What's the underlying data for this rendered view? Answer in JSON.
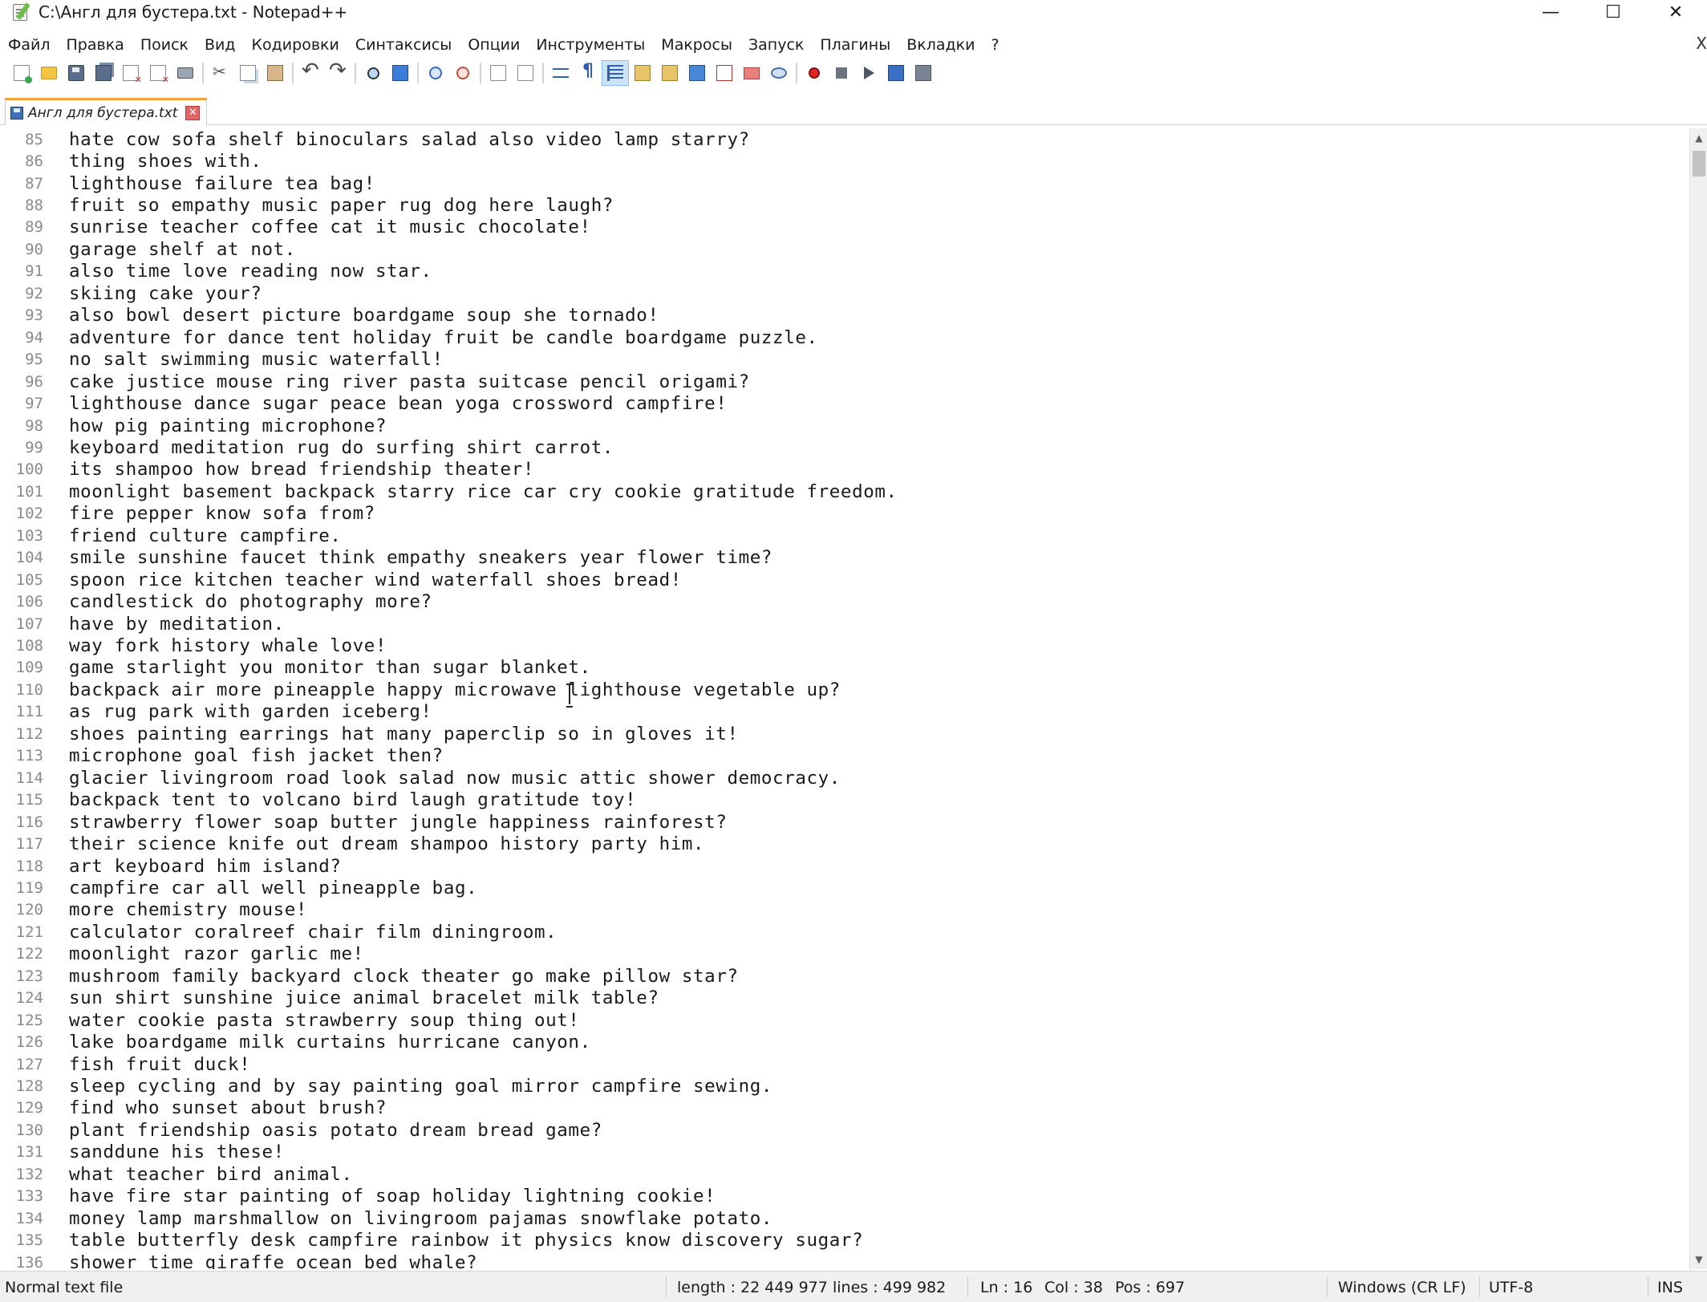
{
  "window": {
    "title": "C:\\Англ для бустера.txt - Notepad++",
    "minimize": "—",
    "maximize": "☐",
    "close": "✕"
  },
  "menu": {
    "items": [
      "Файл",
      "Правка",
      "Поиск",
      "Вид",
      "Кодировки",
      "Синтаксисы",
      "Опции",
      "Инструменты",
      "Макросы",
      "Запуск",
      "Плагины",
      "Вкладки",
      "?"
    ],
    "close_doc": "X"
  },
  "toolbar": {
    "buttons": [
      "new-file",
      "open-file",
      "save",
      "save-all",
      "close",
      "close-all",
      "print",
      "cut",
      "copy",
      "paste",
      "undo",
      "redo",
      "find",
      "replace",
      "zoom-in",
      "zoom-out",
      "sync-vertical",
      "sync-horizontal",
      "word-wrap",
      "show-all-chars",
      "indent-guide",
      "document-map",
      "function-list",
      "folder-as-workspace",
      "monitoring",
      "doc-list",
      "record-macro",
      "stop-recording",
      "playback-macro",
      "run-macro-multiple",
      "save-macro"
    ]
  },
  "tab": {
    "label": "Англ для бустера.txt",
    "close": "✕"
  },
  "editor": {
    "lines": [
      {
        "n": "85",
        "t": "hate cow sofa shelf binoculars salad also video lamp starry?"
      },
      {
        "n": "86",
        "t": "thing shoes with."
      },
      {
        "n": "87",
        "t": "lighthouse failure tea bag!"
      },
      {
        "n": "88",
        "t": "fruit so empathy music paper rug dog here laugh?"
      },
      {
        "n": "89",
        "t": "sunrise teacher coffee cat it music chocolate!"
      },
      {
        "n": "90",
        "t": "garage shelf at not."
      },
      {
        "n": "91",
        "t": "also time love reading now star."
      },
      {
        "n": "92",
        "t": "skiing cake your?"
      },
      {
        "n": "93",
        "t": "also bowl desert picture boardgame soup she tornado!"
      },
      {
        "n": "94",
        "t": "adventure for dance tent holiday fruit be candle boardgame puzzle."
      },
      {
        "n": "95",
        "t": "no salt swimming music waterfall!"
      },
      {
        "n": "96",
        "t": "cake justice mouse ring river pasta suitcase pencil origami?"
      },
      {
        "n": "97",
        "t": "lighthouse dance sugar peace bean yoga crossword campfire!"
      },
      {
        "n": "98",
        "t": "how pig painting microphone?"
      },
      {
        "n": "99",
        "t": "keyboard meditation rug do surfing shirt carrot."
      },
      {
        "n": "100",
        "t": "its shampoo how bread friendship theater!"
      },
      {
        "n": "101",
        "t": "moonlight basement backpack starry rice car cry cookie gratitude freedom."
      },
      {
        "n": "102",
        "t": "fire pepper know sofa from?"
      },
      {
        "n": "103",
        "t": "friend culture campfire."
      },
      {
        "n": "104",
        "t": "smile sunshine faucet think empathy sneakers year flower time?"
      },
      {
        "n": "105",
        "t": "spoon rice kitchen teacher wind waterfall shoes bread!"
      },
      {
        "n": "106",
        "t": "candlestick do photography more?"
      },
      {
        "n": "107",
        "t": "have by meditation."
      },
      {
        "n": "108",
        "t": "way fork history whale love!"
      },
      {
        "n": "109",
        "t": "game starlight you monitor than sugar blanket."
      },
      {
        "n": "110",
        "t": "backpack air more pineapple happy microwave lighthouse vegetable up?"
      },
      {
        "n": "111",
        "t": "as rug park with garden iceberg!"
      },
      {
        "n": "112",
        "t": "shoes painting earrings hat many paperclip so in gloves it!"
      },
      {
        "n": "113",
        "t": "microphone goal fish jacket then?"
      },
      {
        "n": "114",
        "t": "glacier livingroom road look salad now music attic shower democracy."
      },
      {
        "n": "115",
        "t": "backpack tent to volcano bird laugh gratitude toy!"
      },
      {
        "n": "116",
        "t": "strawberry flower soap butter jungle happiness rainforest?"
      },
      {
        "n": "117",
        "t": "their science knife out dream shampoo history party him."
      },
      {
        "n": "118",
        "t": "art keyboard him island?"
      },
      {
        "n": "119",
        "t": "campfire car all well pineapple bag."
      },
      {
        "n": "120",
        "t": "more chemistry mouse!"
      },
      {
        "n": "121",
        "t": "calculator coralreef chair film diningroom."
      },
      {
        "n": "122",
        "t": "moonlight razor garlic me!"
      },
      {
        "n": "123",
        "t": "mushroom family backyard clock theater go make pillow star?"
      },
      {
        "n": "124",
        "t": "sun shirt sunshine juice animal bracelet milk table?"
      },
      {
        "n": "125",
        "t": "water cookie pasta strawberry soup thing out!"
      },
      {
        "n": "126",
        "t": "lake boardgame milk curtains hurricane canyon."
      },
      {
        "n": "127",
        "t": "fish fruit duck!"
      },
      {
        "n": "128",
        "t": "sleep cycling and by say painting goal mirror campfire sewing."
      },
      {
        "n": "129",
        "t": "find who sunset about brush?"
      },
      {
        "n": "130",
        "t": "plant friendship oasis potato dream bread game?"
      },
      {
        "n": "131",
        "t": "sanddune his these!"
      },
      {
        "n": "132",
        "t": "what teacher bird animal."
      },
      {
        "n": "133",
        "t": "have fire star painting of soap holiday lightning cookie!"
      },
      {
        "n": "134",
        "t": "money lamp marshmallow on livingroom pajamas snowflake potato."
      },
      {
        "n": "135",
        "t": "table butterfly desk campfire rainbow it physics know discovery sugar?"
      },
      {
        "n": "136",
        "t": "shower time giraffe ocean bed whale?"
      }
    ]
  },
  "scrollbar": {
    "up": "▲",
    "down": "▼"
  },
  "status": {
    "file_type": "Normal text file",
    "length": "length : 22 449 977",
    "lines": "lines : 499 982",
    "ln": "Ln : 16",
    "col": "Col : 38",
    "pos": "Pos : 697",
    "eol": "Windows (CR LF)",
    "encoding": "UTF-8",
    "mode": "INS"
  }
}
